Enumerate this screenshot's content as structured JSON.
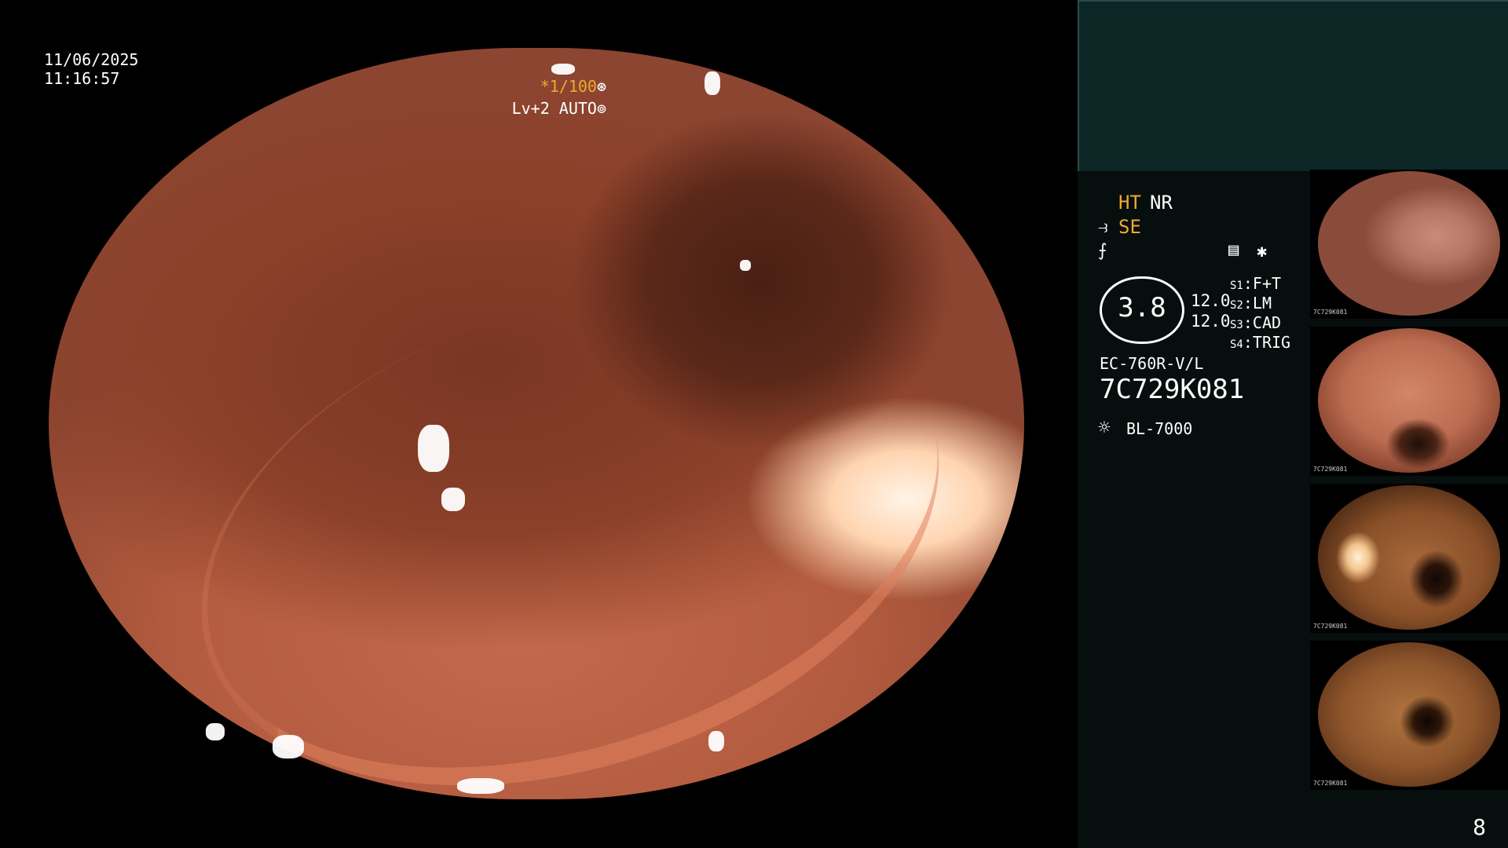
{
  "overlay": {
    "date": "11/06/2025",
    "time": "11:16:57",
    "shutter": "*1/100",
    "level": "Lv+2 AUTO"
  },
  "panel": {
    "modes": {
      "ht": "HT",
      "nr": "NR",
      "se": "SE"
    },
    "value_main": "3.8",
    "value_a": "12.0",
    "value_b": "12.0",
    "slots": [
      {
        "key": "S1",
        "value": "F+T"
      },
      {
        "key": "S2",
        "value": "LM"
      },
      {
        "key": "S3",
        "value": "CAD"
      },
      {
        "key": "S4",
        "value": "TRIG"
      }
    ],
    "scope_model": "EC-760R-V/L",
    "scope_serial": "7C729K081",
    "light_source": "BL-7000",
    "page_number": "8",
    "thumbnails": [
      {
        "label": "7C729K081"
      },
      {
        "label": "7C729K081"
      },
      {
        "label": "7C729K081"
      },
      {
        "label": "7C729K081"
      }
    ],
    "icons": [
      "scope-tip-icon",
      "freeze-icon",
      "record-icon",
      "asterisk-icon",
      "light-source-icon",
      "aperture-icon"
    ]
  },
  "colors": {
    "accent_orange": "#f0a830",
    "panel_top": "#0c2626",
    "panel_bg": "#070e0e"
  }
}
